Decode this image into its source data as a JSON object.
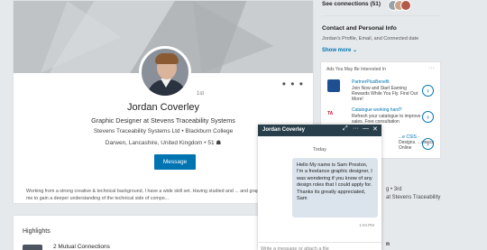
{
  "profile": {
    "degree": "1st",
    "name": "Jordan Coverley",
    "headline": "Graphic Designer at Stevens Traceability Systems",
    "company_line": "Stevens Traceability Systems Ltd • Blackburn College",
    "location_line": "Darwen, Lancashire, United Kingdom • 51 ☗",
    "message_label": "Message",
    "more_label": "• • •",
    "summary": "Working from a strong creative & technical background, I have a wide skill set. Having studied and ... and graphic design, this allowed me to gain a deeper understanding of the technical side of compo..."
  },
  "highlights": {
    "title": "Highlights",
    "mutual_label": "2 Mutual Connections"
  },
  "right": {
    "see_connections": "See connections (51)",
    "contact_title": "Contact and Personal Info",
    "contact_sub": "Jordan's Profile, Email, and Connected date",
    "show_more": "Show more ⌄",
    "peek_degree": "g • 3rd",
    "peek_company": "at Stevens Traceability",
    "peek_n": "n"
  },
  "ads": {
    "header": "Ads You May Be Interested In",
    "dots": "···",
    "items": [
      {
        "title": "PartnerPlusBenefit",
        "desc": "Join Now and Start Earning Rewards While You Fly. Find Out More!"
      },
      {
        "title": "Catalogue working hard?",
        "desc": "Refresh your catalogue to improve sales. Free consultation"
      },
      {
        "title": "...e CSIS -",
        "desc": "Designs. ...siness Online"
      }
    ],
    "ta_logo": "TA"
  },
  "messaging": {
    "name": "Jordan Coverley",
    "expand_icon": "⤢",
    "more_icon": "···",
    "minimize_icon": "—",
    "close_icon": "✕",
    "date": "Today",
    "message": "Hello My name is Sam Preston, I'm a freelance graphic designer, I was wondering if you know of any design roles that I could apply for. Thanks its greatly appreciated, Sam",
    "time": "1:04 PM",
    "input_placeholder": "Write a message or attach a file"
  },
  "colors": {
    "accent": "#0073b1",
    "messaging_header": "#283e4a",
    "bubble": "#dbe4ec"
  }
}
